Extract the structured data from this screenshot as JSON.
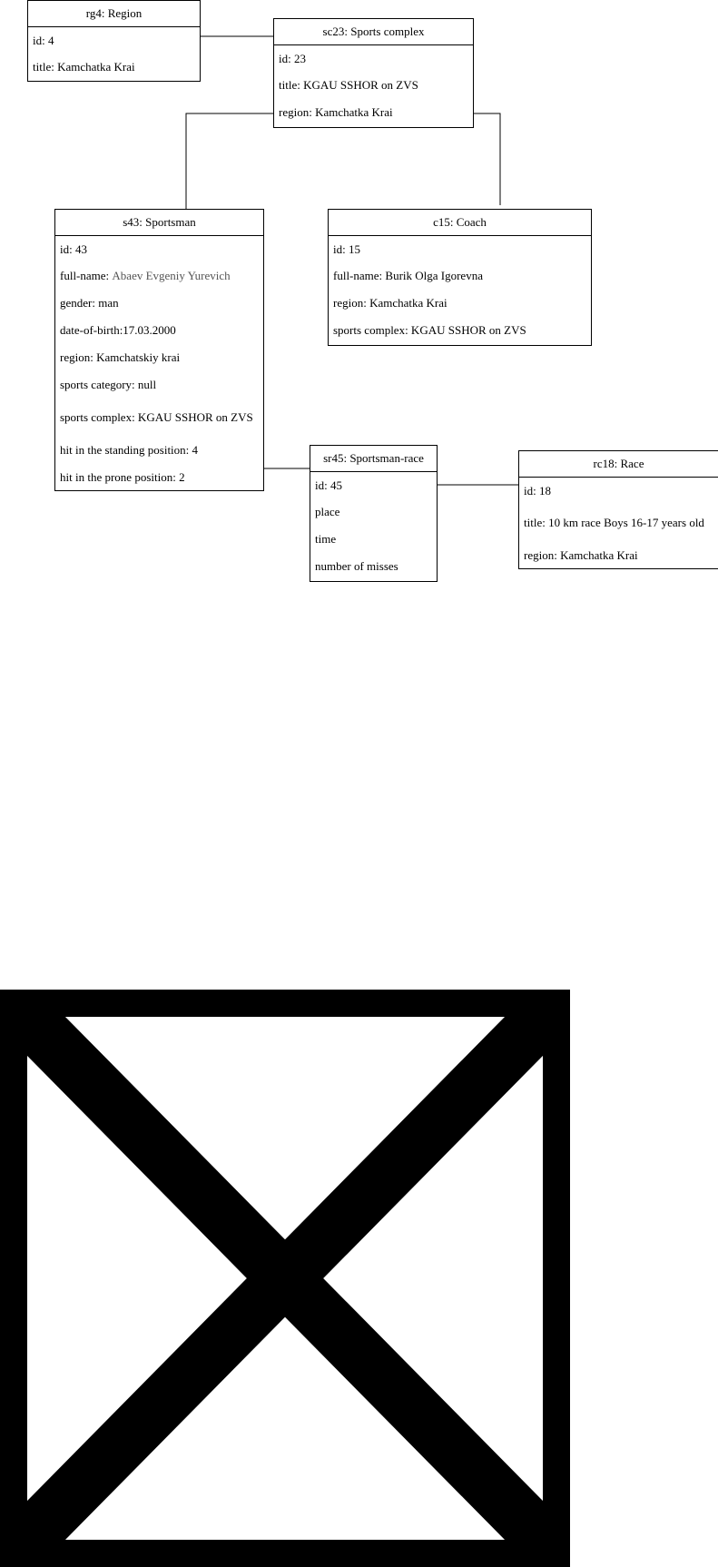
{
  "objects": {
    "region": {
      "header": "rg4: Region",
      "attrs": [
        "id: 4",
        "title: Kamchatka Krai"
      ]
    },
    "sports_complex": {
      "header": "sc23: Sports complex",
      "attrs": [
        "id: 23",
        "title: KGAU SSHOR on ZVS",
        "region: Kamchatka Krai"
      ]
    },
    "sportsman": {
      "header": "s43: Sportsman",
      "attrs": [
        "id: 43",
        "full-name: ",
        "gender: man",
        "date-of-birth:17.03.2000",
        "region: Kamchatskiy krai",
        "sports category: null",
        "sports complex: KGAU SSHOR on ZVS",
        "hit in the standing position: 4",
        "hit in the prone position: 2"
      ],
      "full_name_value": "Abaev Evgeniy Yurevich"
    },
    "coach": {
      "header": "c15: Coach",
      "attrs": [
        "id: 15",
        "full-name: Burik Olga Igorevna",
        "region: Kamchatka Krai",
        "sports complex: KGAU SSHOR on ZVS"
      ]
    },
    "sportsman_race": {
      "header": "sr45: Sportsman-race",
      "attrs": [
        "id: 45",
        "place",
        "time",
        "number of misses"
      ]
    },
    "race": {
      "header": "rc18: Race",
      "attrs": [
        "id: 18",
        "title: 10 km race Boys 16-17 years old",
        "region: Kamchatka Krai"
      ]
    }
  },
  "icons": {
    "broken_image": "broken-image-icon"
  }
}
